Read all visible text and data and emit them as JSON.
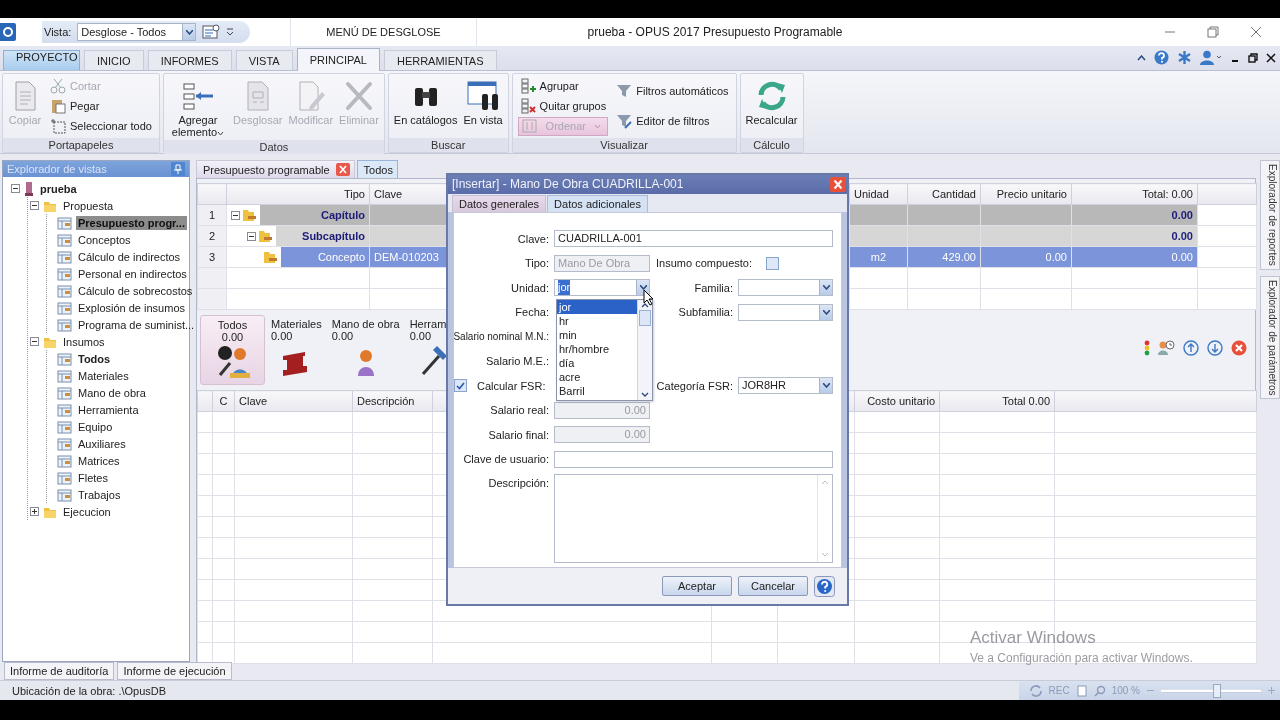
{
  "quick_access": {
    "vista_label": "Vista:",
    "vista_value": "Desglose - Todos"
  },
  "context_tab": "MENÚ DE DESGLOSE",
  "window": {
    "title": "prueba - OPUS 2017 Presupuesto Programable"
  },
  "tabs": [
    {
      "label": "PROYECTO",
      "kind": "app",
      "selected": false
    },
    {
      "label": "INICIO",
      "kind": "tab",
      "selected": false
    },
    {
      "label": "INFORMES",
      "kind": "tab",
      "selected": false
    },
    {
      "label": "VISTA",
      "kind": "tab",
      "selected": false
    },
    {
      "label": "PRINCIPAL",
      "kind": "tab",
      "selected": true
    },
    {
      "label": "HERRAMIENTAS",
      "kind": "tab",
      "selected": false
    }
  ],
  "ribbon": {
    "groups": [
      {
        "title": "Portapapeles",
        "columns": [
          {
            "kind": "large",
            "items": [
              {
                "label": "Copiar",
                "disabled": true
              }
            ]
          },
          {
            "kind": "small",
            "items": [
              {
                "label": "Cortar",
                "disabled": true
              },
              {
                "label": "Pegar",
                "disabled": false
              },
              {
                "label": "Seleccionar todo",
                "disabled": false
              }
            ]
          }
        ]
      },
      {
        "title": "Datos",
        "columns": [
          {
            "kind": "large",
            "items": [
              {
                "label": "Agregar elemento",
                "disabled": false,
                "menu": true
              },
              {
                "label": "Desglosar",
                "disabled": true
              },
              {
                "label": "Modificar",
                "disabled": true
              },
              {
                "label": "Eliminar",
                "disabled": true
              }
            ]
          }
        ]
      },
      {
        "title": "Buscar",
        "columns": [
          {
            "kind": "large",
            "items": [
              {
                "label": "En catálogos",
                "disabled": false
              },
              {
                "label": "En vista",
                "disabled": false
              }
            ]
          }
        ]
      },
      {
        "title": "Visualizar",
        "columns": [
          {
            "kind": "small",
            "items": [
              {
                "label": "Agrupar",
                "disabled": false
              },
              {
                "label": "Quitar grupos",
                "disabled": false
              },
              {
                "label": "Ordenar",
                "disabled": true,
                "menu": true
              }
            ]
          },
          {
            "kind": "small",
            "items": [
              {
                "label": "Filtros automáticos",
                "disabled": false
              },
              {
                "label": "Editor de filtros",
                "disabled": false
              }
            ]
          }
        ]
      },
      {
        "title": "Cálculo",
        "columns": [
          {
            "kind": "large",
            "items": [
              {
                "label": "Recalcular",
                "disabled": false
              }
            ]
          }
        ]
      }
    ]
  },
  "explorer": {
    "title": "Explorador de vistas",
    "tree": [
      {
        "label": "prueba",
        "expanded": true,
        "children": [
          {
            "label": "Propuesta",
            "expanded": true,
            "children": [
              {
                "label": "Presupuesto progr...",
                "selected": true,
                "bold": true
              },
              {
                "label": "Conceptos",
                "selected": false,
                "bold": false
              },
              {
                "label": "Cálculo de indirectos",
                "selected": false,
                "bold": false
              },
              {
                "label": "Personal en indirectos",
                "selected": false,
                "bold": false
              },
              {
                "label": "Cálculo de sobrecostos",
                "selected": false,
                "bold": false
              },
              {
                "label": "Explosión de insumos",
                "selected": false,
                "bold": false
              },
              {
                "label": "Programa de suminist...",
                "selected": false,
                "bold": false
              }
            ]
          },
          {
            "label": "Insumos",
            "expanded": true,
            "children": [
              {
                "label": "Todos",
                "selected": false,
                "bold": true
              },
              {
                "label": "Materiales",
                "selected": false,
                "bold": false
              },
              {
                "label": "Mano de obra",
                "selected": false,
                "bold": false
              },
              {
                "label": "Herramienta",
                "selected": false,
                "bold": false
              },
              {
                "label": "Equipo",
                "selected": false,
                "bold": false
              },
              {
                "label": "Auxiliares",
                "selected": false,
                "bold": false
              },
              {
                "label": "Matrices",
                "selected": false,
                "bold": false
              },
              {
                "label": "Fletes",
                "selected": false,
                "bold": false
              },
              {
                "label": "Trabajos",
                "selected": false,
                "bold": false
              }
            ]
          },
          {
            "label": "Ejecucion",
            "expanded": false
          }
        ]
      }
    ]
  },
  "doc_tabs": [
    {
      "label": "Presupuesto programable",
      "selected": false,
      "closable": true
    },
    {
      "label": "Todos",
      "selected": true,
      "closable": false
    }
  ],
  "budget_grid": {
    "columns": [
      "Tipo",
      "Clave",
      "Unidad",
      "Cantidad",
      "Precio unitario",
      "Total: 0.00"
    ],
    "rows": [
      {
        "number": "1",
        "kind": "capitulo",
        "tipo": "Capítulo",
        "clave": "",
        "unidad": "",
        "cantidad": "",
        "precio": "",
        "total": "0.00",
        "selected": false,
        "expanded": true
      },
      {
        "number": "2",
        "kind": "subcapitulo",
        "tipo": "Subcapítulo",
        "clave": "",
        "unidad": "",
        "cantidad": "",
        "precio": "",
        "total": "0.00",
        "selected": false,
        "expanded": true
      },
      {
        "number": "3",
        "kind": "concepto",
        "tipo": "Concepto",
        "clave": "DEM-010203",
        "unidad": "m2",
        "cantidad": "429.00",
        "precio": "0.00",
        "total": "0.00",
        "selected": true
      }
    ]
  },
  "categories": [
    {
      "label": "Todos",
      "value": "0.00",
      "selected": true
    },
    {
      "label": "Materiales",
      "value": "0.00",
      "selected": false
    },
    {
      "label": "Mano de obra",
      "value": "0.00",
      "selected": false
    },
    {
      "label": "Herram",
      "value": "0.00",
      "selected": false
    }
  ],
  "supplies_grid": {
    "columns": [
      "C",
      "Clave",
      "Descripción",
      "Costo unitario",
      "Total 0.00"
    ]
  },
  "side_tabs": [
    "Explorador de reportes",
    "Explorador de parámetros"
  ],
  "bottom_tabs": [
    "Informe de auditoría",
    "Informe de ejecución"
  ],
  "status_bar": {
    "location": "Ubicación de la obra: .\\OpusDB",
    "rec": "REC",
    "zoom": "100 %",
    "zoom_slider": {
      "level": 0.55
    }
  },
  "activation": {
    "title": "Activar Windows",
    "text": "Ve a Configuración para activar Windows."
  },
  "dialog": {
    "title": "[Insertar] - Mano De Obra CUADRILLA-001",
    "tabs": [
      {
        "label": "Datos generales",
        "selected": true
      },
      {
        "label": "Datos adicionales",
        "selected": false
      }
    ],
    "clave_label": "Clave:",
    "clave": "CUADRILLA-001",
    "tipo_label": "Tipo:",
    "tipo": "Mano De Obra",
    "compuesto_label": "Insumo compuesto:",
    "compuesto_checked": false,
    "unidad_label": "Unidad:",
    "unidad": "jor",
    "familia_label": "Familia:",
    "fecha_label": "Fecha:",
    "subfamilia_label": "Subfamilia:",
    "salario_nominal_label": "Salario nominal M.N.:",
    "salario_me_label": "Salario M.E.:",
    "fsr_label": "Calcular FSR:",
    "fsr_checked": true,
    "categoria_label": "Categoría FSR:",
    "categoria": "JOR8HR",
    "salario_real_label": "Salario real:",
    "salario_real": "0.00",
    "salario_final_label": "Salario final:",
    "salario_final": "0.00",
    "clave_usuario_label": "Clave de usuario:",
    "descripcion_label": "Descripción:",
    "unit_options": [
      {
        "label": "jor",
        "selected": true
      },
      {
        "label": "hr",
        "selected": false
      },
      {
        "label": "min",
        "selected": false
      },
      {
        "label": "hr/hombre",
        "selected": false
      },
      {
        "label": "día",
        "selected": false
      },
      {
        "label": "acre",
        "selected": false
      },
      {
        "label": "Barril",
        "selected": false
      }
    ],
    "buttons": [
      "Aceptar",
      "Cancelar"
    ]
  }
}
